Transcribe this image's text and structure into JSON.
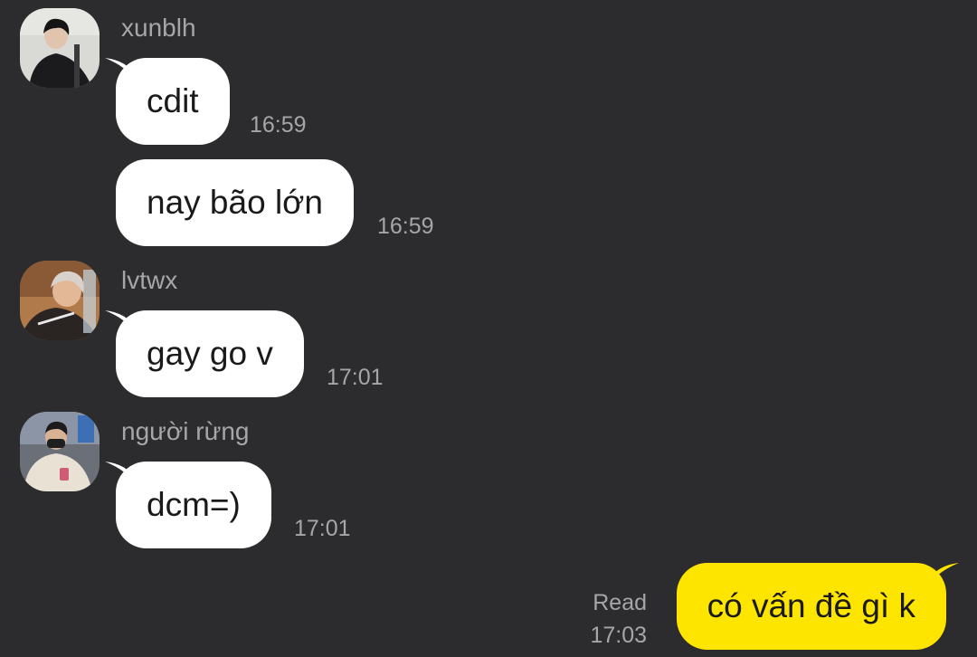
{
  "messages": [
    {
      "sender": "xunblh",
      "text": "cdit",
      "time": "16:59"
    },
    {
      "text": "nay bão lớn",
      "time": "16:59"
    },
    {
      "sender": "lvtwx",
      "text": "gay go v",
      "time": "17:01"
    },
    {
      "sender": "người rừng",
      "text": "dcm=)",
      "time": "17:01"
    },
    {
      "text": "có vấn đề gì k",
      "time": "17:03",
      "status": "Read",
      "outgoing": true
    }
  ],
  "colors": {
    "background": "#2c2c2e",
    "incoming_bubble": "#ffffff",
    "outgoing_bubble": "#fee500",
    "meta_text": "#a6a6a8"
  },
  "icons": [
    "avatar-xunblh",
    "avatar-lvtwx",
    "avatar-nguoi-rung",
    "bubble-tail"
  ]
}
